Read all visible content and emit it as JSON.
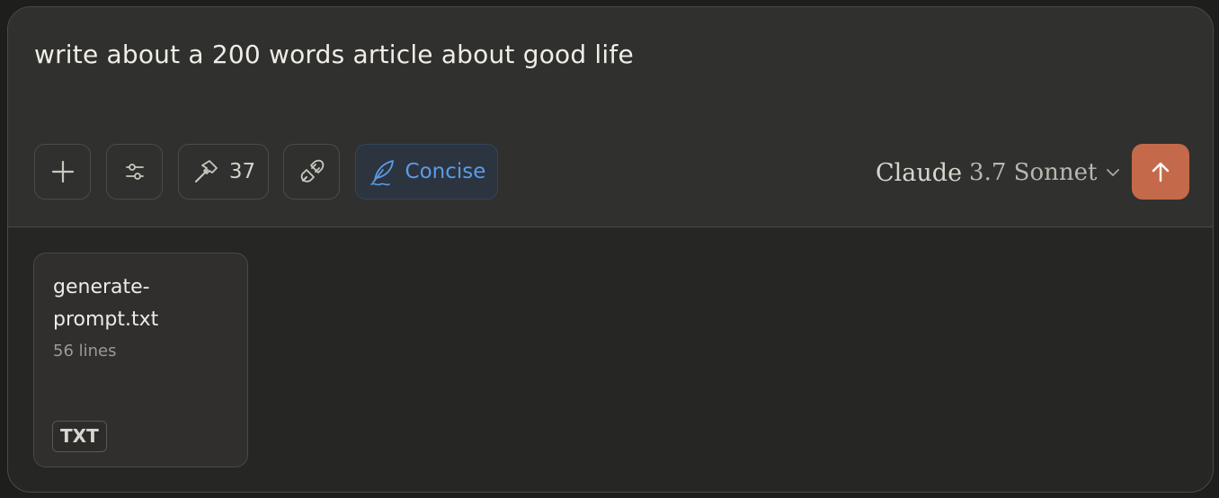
{
  "composer": {
    "prompt": "write about a 200 words article about good life",
    "tools_count": "37",
    "style_label": "Concise",
    "model": {
      "name": "Claude",
      "version": "3.7 Sonnet"
    },
    "icons": {
      "add": "plus-icon",
      "settings": "sliders-icon",
      "tools": "hammer-icon",
      "connect": "plug-icon",
      "style": "feather-icon",
      "model_dropdown": "chevron-down-icon",
      "send": "arrow-up-icon"
    },
    "colors": {
      "accent_send": "#c46a4b",
      "style_blue": "#5c9be6"
    }
  },
  "attachments": [
    {
      "file_name": "generate-prompt.txt",
      "line_count": "56 lines",
      "type_badge": "TXT"
    }
  ]
}
